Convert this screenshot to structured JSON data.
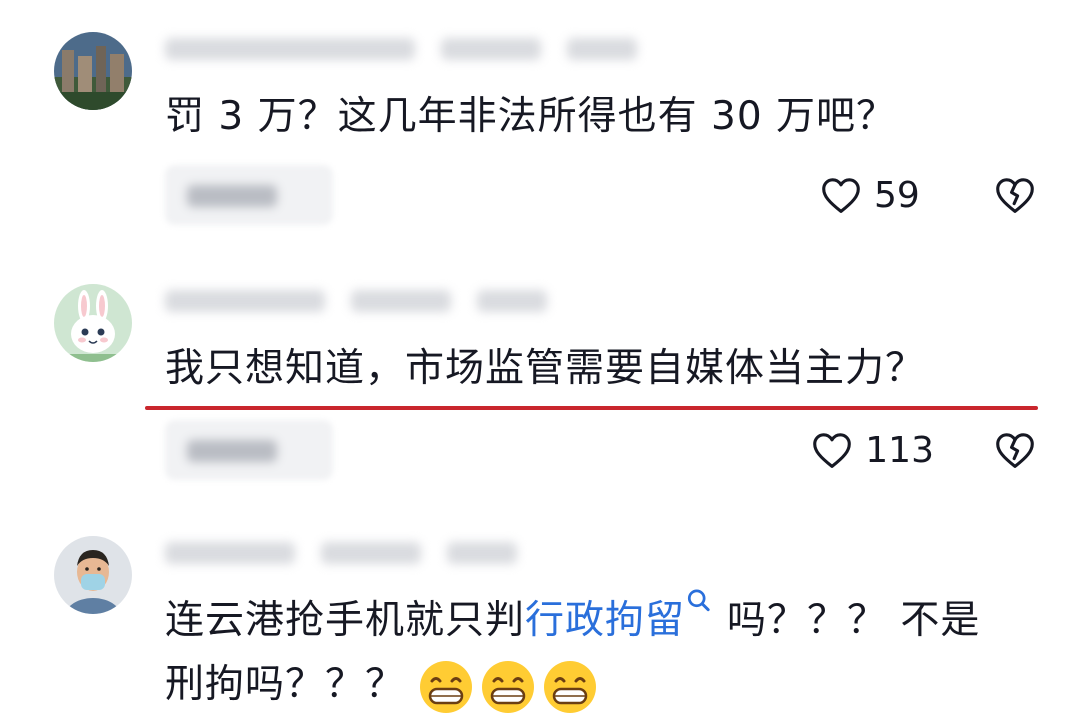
{
  "comments": [
    {
      "text": "罚 3 万？这几年非法所得也有 30 万吧？",
      "likes": "59"
    },
    {
      "text": "我只想知道，市场监管需要自媒体当主力？",
      "likes": "113"
    },
    {
      "text_before": "连云港抢手机就只判",
      "link": "行政拘留",
      "text_after": "吗？？？ 不是",
      "line2": "刑拘吗？？？"
    }
  ],
  "icons": {
    "like": "heart-outline-icon",
    "dislike": "broken-heart-icon",
    "search": "search-icon",
    "emoji": "grinning-face-emoji"
  },
  "colors": {
    "highlight_underline": "#c9262d",
    "link": "#2a6fdb",
    "text": "#161823"
  }
}
